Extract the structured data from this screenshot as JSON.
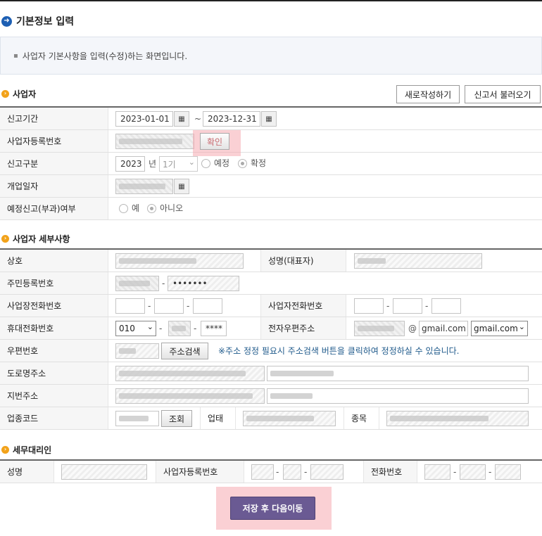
{
  "page": {
    "title": "기본정보 입력",
    "description": "사업자 기본사항을 입력(수정)하는 화면입니다."
  },
  "sections": {
    "business": "사업자",
    "details": "사업자 세부사항",
    "agent": "세무대리인"
  },
  "top_buttons": {
    "new": "새로작성하기",
    "load": "신고서 불러오기"
  },
  "business": {
    "period_label": "신고기간",
    "period_start": "2023-01-01",
    "period_end": "2023-12-31",
    "tilde": "~",
    "reg_no_label": "사업자등록번호",
    "confirm_button": "확인",
    "report_type_label": "신고구분",
    "year": "2023",
    "year_unit": "년",
    "term": "1기",
    "radio_planned": "예정",
    "radio_final": "확정",
    "start_date_label": "개업일자",
    "planned_tax_label": "예정신고(부과)여부",
    "radio_yes": "예",
    "radio_no": "아니오"
  },
  "details": {
    "trade_name_label": "상호",
    "rep_name_label": "성명(대표자)",
    "resident_no_label": "주민등록번호",
    "resident_no_back": "•••••••",
    "biz_phone_label": "사업장전화번호",
    "biz_tel_label": "사업자전화번호",
    "mobile_label": "휴대전화번호",
    "mobile_prefix": "010",
    "mobile_last": "****",
    "email_label": "전자우편주소",
    "email_at": "@",
    "email_domain": "gmail.com",
    "email_select": "gmail.com",
    "postal_label": "우편번호",
    "address_search_button": "주소검색",
    "notice": "※주소 정정 필요시 주소검색 버튼을 클릭하여 정정하실 수 있습니다.",
    "road_addr_label": "도로명주소",
    "lot_addr_label": "지번주소",
    "industry_code_label": "업종코드",
    "lookup_button": "조회",
    "business_type_label": "업태",
    "item_label": "종목",
    "dash": "-"
  },
  "agent": {
    "name_label": "성명",
    "reg_no_label": "사업자등록번호",
    "phone_label": "전화번호"
  },
  "footer": {
    "save_next": "저장 후 다음이동"
  },
  "colors": {
    "title_icon": "#1d5fb3",
    "section_icon": "#f2a21a",
    "save_button": "#6a5a93",
    "highlight": "#f6aab0",
    "notice_text": "#1f5a8b"
  }
}
